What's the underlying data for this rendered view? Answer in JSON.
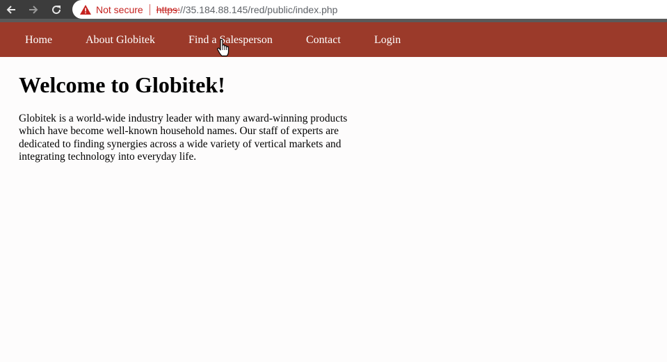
{
  "browser": {
    "security_label": "Not secure",
    "url_scheme": "https:",
    "url_rest": "//35.184.88.145/red/public/index.php"
  },
  "nav": {
    "items": [
      {
        "label": "Home"
      },
      {
        "label": "About Globitek"
      },
      {
        "label": "Find a Salesperson"
      },
      {
        "label": "Contact"
      },
      {
        "label": "Login"
      }
    ]
  },
  "main": {
    "title": "Welcome to Globitek!",
    "paragraph": "Globitek is a world-wide industry leader with many award-winning products which have become well-known household names. Our staff of experts are dedicated to finding synergies across a wide variety of vertical markets and integrating technology into everyday life."
  },
  "colors": {
    "nav_background": "#9b3a2a",
    "insecure_red": "#c5221f"
  }
}
